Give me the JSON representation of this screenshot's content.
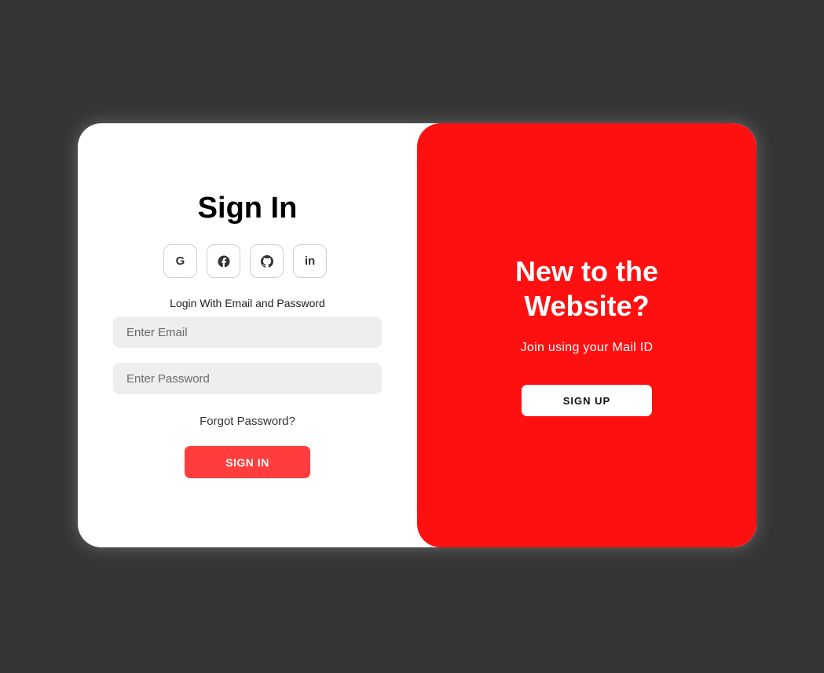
{
  "colors": {
    "page_background": "#353535",
    "card_background": "#ffffff",
    "accent_panel": "#ff1010",
    "signin_button": "#ff3d3d",
    "input_background": "#eeeeee"
  },
  "signin": {
    "title": "Sign In",
    "social_buttons": [
      {
        "icon": "google-icon",
        "glyph": "G"
      },
      {
        "icon": "facebook-icon"
      },
      {
        "icon": "github-icon"
      },
      {
        "icon": "linkedin-icon",
        "glyph": "in"
      }
    ],
    "hint": "Login With Email and Password",
    "email_placeholder": "Enter Email",
    "password_placeholder": "Enter Password",
    "forgot_label": "Forgot Password?",
    "button_label": "SIGN IN"
  },
  "signup": {
    "title_line1": "New to the",
    "title_line2": "Website?",
    "subtitle": "Join using your Mail ID",
    "button_label": "SIGN UP"
  }
}
